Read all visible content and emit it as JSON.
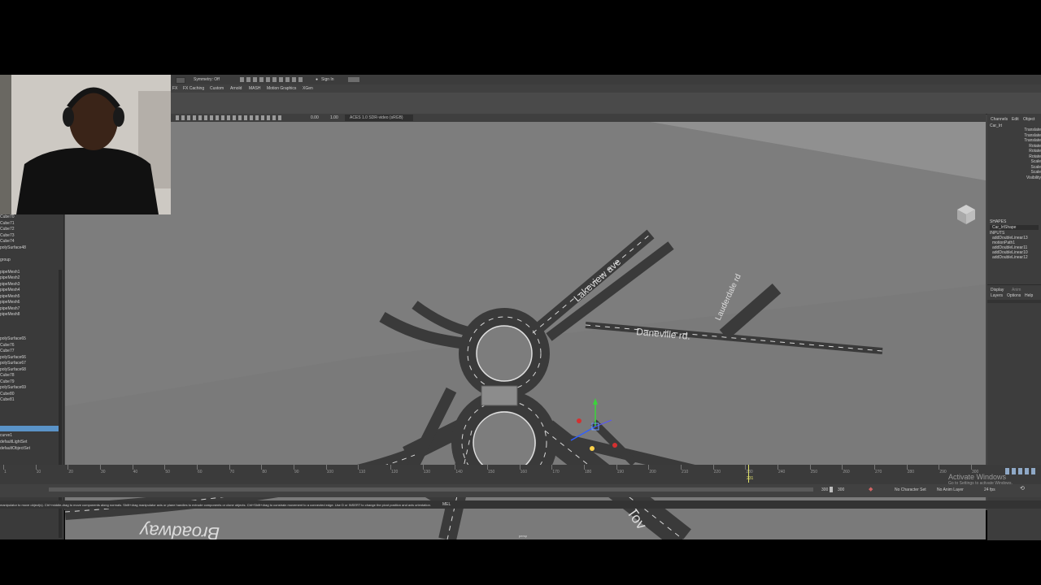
{
  "statusline": {
    "symmetry_label": "Symmetry: Off",
    "signin_label": "Sign In"
  },
  "shelf_tabs": [
    "FX",
    "FX Caching",
    "Custom",
    "Arnold",
    "MASH",
    "Motion Graphics",
    "XGen"
  ],
  "viewport_bar": {
    "field1": "0.00",
    "field2": "1.00",
    "colorspace": "ACES 1.0 SDR-video (sRGB)"
  },
  "channel_box": {
    "tabs": [
      "Channels",
      "Edit",
      "Object"
    ],
    "object_name": "Car_lrt",
    "attributes": [
      "Translate",
      "Translate",
      "Translate",
      "Rotate",
      "Rotate",
      "Rotate",
      "Scale",
      "Scale",
      "Scale",
      "Visibility"
    ],
    "shapes_header": "SHAPES",
    "shape_name": "Car_lrtShape",
    "inputs_header": "INPUTS",
    "inputs": [
      "addDoubleLinear13",
      "motionPath1",
      "addDoubleLinear11",
      "addDoubleLinear10",
      "addDoubleLinear12"
    ]
  },
  "layer_panel": {
    "tabs": [
      "Display",
      "Anim"
    ],
    "menu": [
      "Layers",
      "Options",
      "Help"
    ]
  },
  "outliner": {
    "items": [
      "Cube70",
      "Cube71",
      "Cube72",
      "Cube73",
      "Cube74",
      "polySurface48",
      "",
      "group",
      "",
      "pipeMesh1",
      "pipeMesh2",
      "pipeMesh3",
      "pipeMesh4",
      "pipeMesh5",
      "pipeMesh6",
      "pipeMesh7",
      "pipeMesh8",
      "",
      "",
      "",
      "polySurface65",
      "Cube76",
      "Cube77",
      "polySurface66",
      "polySurface67",
      "polySurface68",
      "Cube78",
      "Cube79",
      "polySurface69",
      "Cube80",
      "Cube81",
      "",
      "",
      "",
      ""
    ],
    "bottom_items": [
      "curve1",
      "defaultLightSet",
      "defaultObjectSet"
    ]
  },
  "viewport": {
    "labels": [
      "Lakeview ave",
      "Daneville rd.",
      "Lauderdale rd",
      "Broadway",
      "Tov"
    ],
    "camera": "persp"
  },
  "timeline": {
    "ticks": [
      "1",
      "10",
      "20",
      "30",
      "40",
      "50",
      "60",
      "70",
      "80",
      "90",
      "100",
      "110",
      "120",
      "130",
      "140",
      "150",
      "160",
      "170",
      "180",
      "190",
      "200",
      "210",
      "220",
      "230",
      "240",
      "250",
      "260",
      "270",
      "280",
      "290",
      "300"
    ],
    "current_frame": "231"
  },
  "range": {
    "start": "300",
    "end": "300",
    "character_set": "No Character Set",
    "anim_layer": "No Anim Layer",
    "fps": "24 fps"
  },
  "help_line": {
    "text": "manipulator to move object(s). Ctrl+middle-drag to move components along normals. Shift+drag manipulator axis or plane handles to extrude components or clone objects. Ctrl+Shift+drag to constrain movement to a connected edge. Use D or INSERT to change the pivot position and axis orientation.",
    "mel": "MEL"
  },
  "watermark": {
    "title": "Activate Windows",
    "subtitle": "Go to Settings to activate Windows."
  }
}
